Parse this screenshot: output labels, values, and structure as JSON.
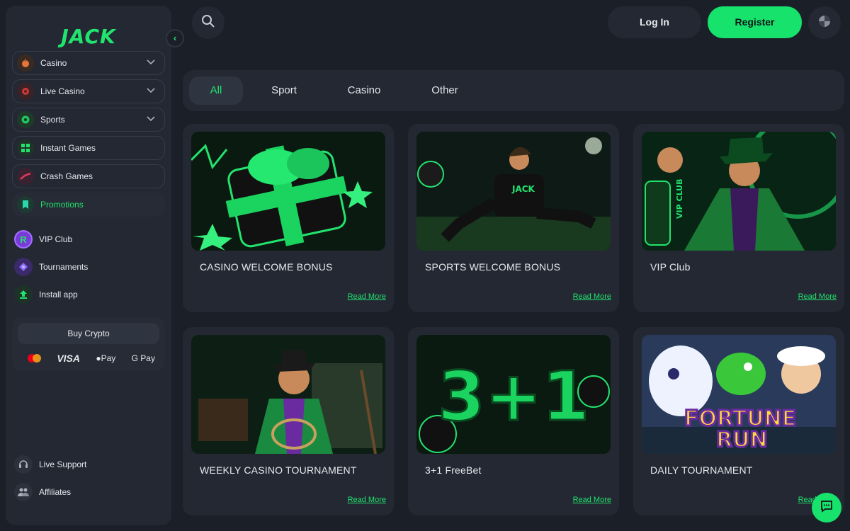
{
  "brand": {
    "logo_text": "JACK",
    "accent": "#22e36e"
  },
  "sidebar": {
    "collapse_icon": "chevron-left-icon",
    "menu": [
      {
        "label": "Casino",
        "icon": "casino-icon",
        "expandable": true
      },
      {
        "label": "Live Casino",
        "icon": "live-casino-icon",
        "expandable": true
      },
      {
        "label": "Sports",
        "icon": "sports-icon",
        "expandable": true
      },
      {
        "label": "Instant Games",
        "icon": "instant-games-icon",
        "expandable": false
      },
      {
        "label": "Crash Games",
        "icon": "crash-games-icon",
        "expandable": false
      },
      {
        "label": "Promotions",
        "icon": "promotions-icon",
        "expandable": false,
        "active": true
      }
    ],
    "extras": [
      {
        "label": "VIP Club",
        "icon": "vip-club-icon"
      },
      {
        "label": "Tournaments",
        "icon": "tournaments-icon"
      },
      {
        "label": "Install app",
        "icon": "install-app-icon"
      }
    ],
    "crypto": {
      "buy_label": "Buy Crypto",
      "payments": [
        "VISA",
        "Pay",
        "G Pay"
      ]
    },
    "footer": [
      {
        "label": "Live Support",
        "icon": "headset-icon"
      },
      {
        "label": "Affiliates",
        "icon": "affiliates-icon"
      }
    ]
  },
  "header": {
    "login_label": "Log In",
    "register_label": "Register"
  },
  "tabs": [
    {
      "label": "All",
      "active": true
    },
    {
      "label": "Sport"
    },
    {
      "label": "Casino"
    },
    {
      "label": "Other"
    }
  ],
  "promotions": [
    {
      "title": "CASINO WELCOME BONUS",
      "link": "Read More"
    },
    {
      "title": "SPORTS WELCOME BONUS",
      "link": "Read More"
    },
    {
      "title": "VIP Club",
      "link": "Read More"
    },
    {
      "title": "WEEKLY CASINO TOURNAMENT",
      "link": "Read More"
    },
    {
      "title": "3+1 FreeBet",
      "link": "Read More"
    },
    {
      "title": "DAILY TOURNAMENT",
      "link": "Read More"
    }
  ],
  "images": {
    "promo_5_text": "3+1",
    "promo_6_text": [
      "FORTUNE",
      "RUN"
    ],
    "vip_sign": "VIP CLUB",
    "jersey": "JACK"
  }
}
